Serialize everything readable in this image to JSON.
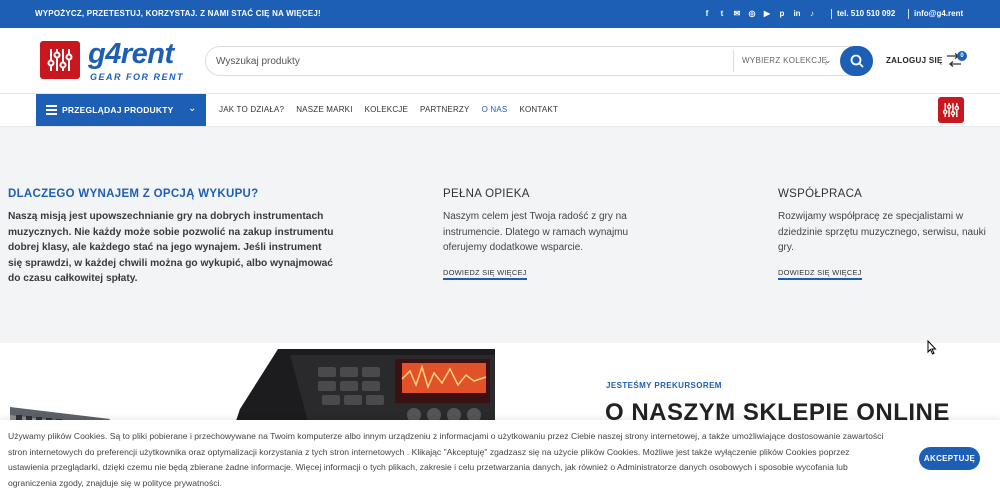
{
  "topbar": {
    "promo": "WYPOŻYCZ, PRZETESTUJ, KORZYSTAJ. Z NAMI STAĆ CIĘ NA WIĘCEJ!",
    "socials": [
      {
        "icon": "facebook-icon",
        "glyph": "f"
      },
      {
        "icon": "twitter-icon",
        "glyph": "t"
      },
      {
        "icon": "email-icon",
        "glyph": "✉"
      },
      {
        "icon": "instagram-icon",
        "glyph": "◎"
      },
      {
        "icon": "youtube-icon",
        "glyph": "▶"
      },
      {
        "icon": "pinterest-icon",
        "glyph": "p"
      },
      {
        "icon": "linkedin-icon",
        "glyph": "in"
      },
      {
        "icon": "tiktok-icon",
        "glyph": "♪"
      }
    ],
    "phone": "tel. 510 510 092",
    "email": "info@g4.rent"
  },
  "header": {
    "logo_text": "g4rent",
    "logo_tagline": "GEAR FOR RENT",
    "search_placeholder": "Wyszukaj produkty",
    "collection_label": "WYBIERZ KOLEKCJĘ",
    "login_label": "ZALOGUJ SIĘ",
    "compare_count": "0"
  },
  "nav": {
    "browse_label": "PRZEGLĄDAJ PRODUKTY",
    "links": [
      "JAK TO DZIAŁA?",
      "NASZE MARKI",
      "KOLEKCJE",
      "PARTNERZY",
      "O NAS",
      "KONTAKT"
    ],
    "active_link": "O NAS"
  },
  "features": [
    {
      "title": "DLACZEGO WYNAJEM Z OPCJĄ WYKUPU?",
      "body": "Naszą misją jest upowszechnianie gry na dobrych instrumentach muzycznych. Nie każdy może sobie pozwolić na zakup instrumentu dobrej klasy, ale każdego stać na jego wynajem. Jeśli instrument się sprawdzi, w każdej chwili można go wykupić, albo wynajmować do czasu całkowitej spłaty."
    },
    {
      "title": "PEŁNA OPIEKA",
      "body": "Naszym celem jest Twoja radość z gry na instrumencie. Dlatego w ramach wynajmu oferujemy dodatkowe wsparcie.",
      "link": "DOWIEDZ SIĘ WIĘCEJ"
    },
    {
      "title": "WSPÓŁPRACA",
      "body": "Rozwijamy współpracę ze specjalistami w dziedzinie sprzętu muzycznego, serwisu, nauki gry.",
      "link": "DOWIEDZ SIĘ WIĘCEJ"
    }
  ],
  "about": {
    "kicker": "JESTEŚMY PREKURSOREM",
    "title": "O NASZYM SKLEPIE ONLINE"
  },
  "cookie": {
    "text": "Używamy plików Cookies. Są to pliki pobierane i przechowywane na Twoim komputerze albo innym urządzeniu z informacjami o użytkowaniu przez Ciebie naszej strony internetowej, a także umożliwiające dostosowanie zawartości stron internetowych do preferencji użytkownika oraz optymalizacji korzystania z tych stron internetowych . Klikając \"Akceptuję\" zgadzasz się na użycie plików Cookies. Możliwe jest także wyłączenie plików Cookies poprzez ustawienia przeglądarki, dzięki czemu nie będą zbierane żadne informacje. Więcej informacji o tych plikach, zakresie i celu przetwarzania danych, jak również o Administratorze danych osobowych i sposobie wycofania lub ograniczenia zgody, znajduje się w polityce prywatności.",
    "accept_label": "AKCEPTUJĘ"
  },
  "colors": {
    "brand_blue": "#1d5fb4",
    "logo_red": "#c8171e"
  }
}
